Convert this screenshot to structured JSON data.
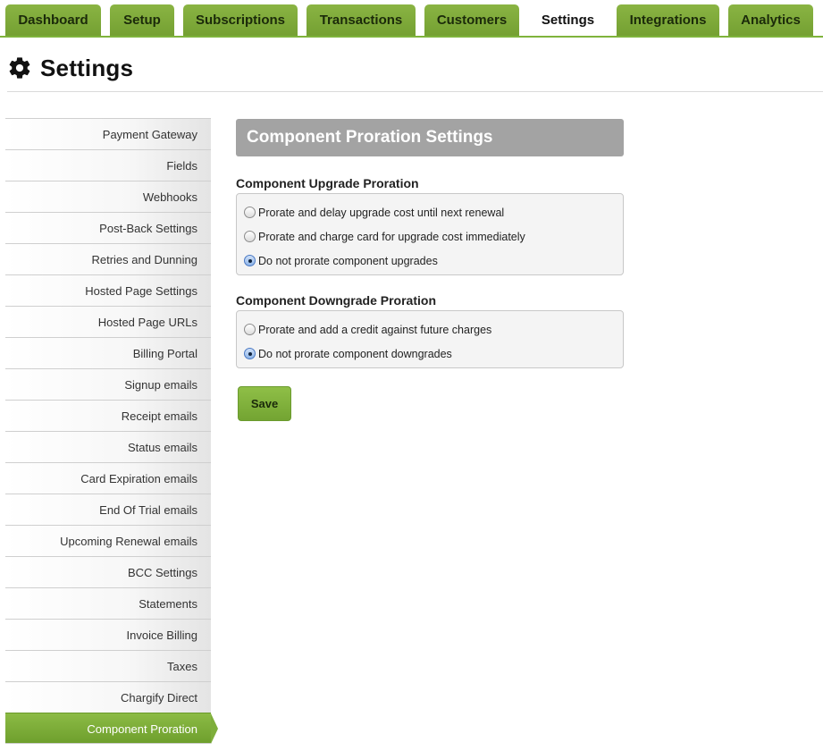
{
  "nav": {
    "tabs": [
      {
        "label": "Dashboard"
      },
      {
        "label": "Setup"
      },
      {
        "label": "Subscriptions"
      },
      {
        "label": "Transactions"
      },
      {
        "label": "Customers"
      },
      {
        "label": "Settings",
        "active": true
      },
      {
        "label": "Integrations"
      },
      {
        "label": "Analytics"
      }
    ]
  },
  "page": {
    "title": "Settings",
    "icon": "gear-icon"
  },
  "sidebar": {
    "items": [
      {
        "label": "Payment Gateway"
      },
      {
        "label": "Fields"
      },
      {
        "label": "Webhooks"
      },
      {
        "label": "Post-Back Settings"
      },
      {
        "label": "Retries and Dunning"
      },
      {
        "label": "Hosted Page Settings"
      },
      {
        "label": "Hosted Page URLs"
      },
      {
        "label": "Billing Portal"
      },
      {
        "label": "Signup emails"
      },
      {
        "label": "Receipt emails"
      },
      {
        "label": "Status emails"
      },
      {
        "label": "Card Expiration emails"
      },
      {
        "label": "End Of Trial emails"
      },
      {
        "label": "Upcoming Renewal emails"
      },
      {
        "label": "BCC Settings"
      },
      {
        "label": "Statements"
      },
      {
        "label": "Invoice Billing"
      },
      {
        "label": "Taxes"
      },
      {
        "label": "Chargify Direct"
      },
      {
        "label": "Component Proration",
        "active": true
      }
    ]
  },
  "main": {
    "header": "Component Proration Settings",
    "upgrade": {
      "label": "Component Upgrade Proration",
      "options": [
        {
          "label": "Prorate and delay upgrade cost until next renewal",
          "checked": false
        },
        {
          "label": "Prorate and charge card for upgrade cost immediately",
          "checked": false
        },
        {
          "label": "Do not prorate component upgrades",
          "checked": true
        }
      ]
    },
    "downgrade": {
      "label": "Component Downgrade Proration",
      "options": [
        {
          "label": "Prorate and add a credit against future charges",
          "checked": false
        },
        {
          "label": "Do not prorate component downgrades",
          "checked": true
        }
      ]
    },
    "save_label": "Save"
  },
  "colors": {
    "accent_green": "#7fb33c",
    "header_gray": "#a3a3a3"
  }
}
